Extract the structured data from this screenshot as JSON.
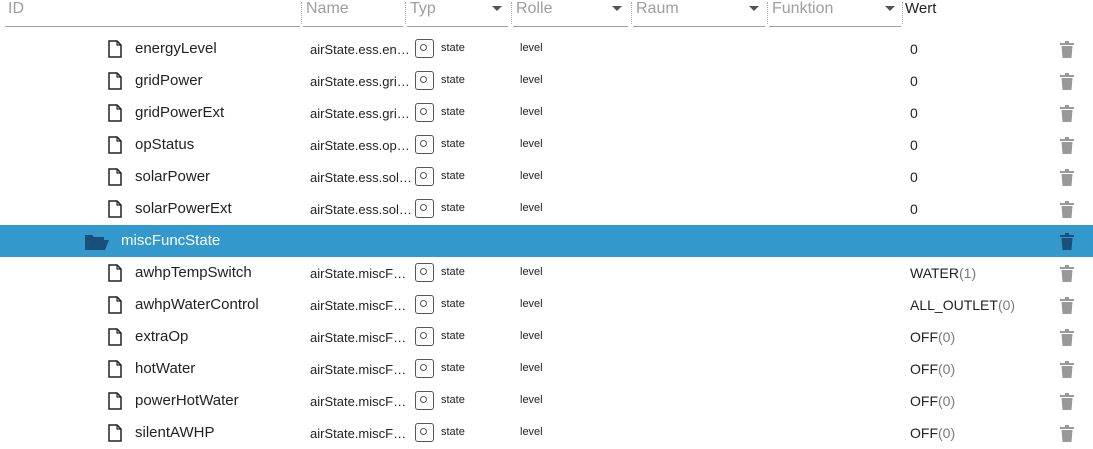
{
  "header": {
    "id_placeholder": "ID",
    "name_placeholder": "Name",
    "typ_label": "Typ",
    "rolle_label": "Rolle",
    "raum_label": "Raum",
    "funktion_label": "Funktion",
    "wert_label": "Wert"
  },
  "rows": [
    {
      "name": "energyLevel",
      "id": "airState.ess.energyLevel",
      "type": "state",
      "role": "level",
      "value": "0",
      "value_num": ""
    },
    {
      "name": "gridPower",
      "id": "airState.ess.gridPower",
      "type": "state",
      "role": "level",
      "value": "0",
      "value_num": ""
    },
    {
      "name": "gridPowerExt",
      "id": "airState.ess.gridPowerExt",
      "type": "state",
      "role": "level",
      "value": "0",
      "value_num": ""
    },
    {
      "name": "opStatus",
      "id": "airState.ess.opStatus",
      "type": "state",
      "role": "level",
      "value": "0",
      "value_num": ""
    },
    {
      "name": "solarPower",
      "id": "airState.ess.solarPower",
      "type": "state",
      "role": "level",
      "value": "0",
      "value_num": ""
    },
    {
      "name": "solarPowerExt",
      "id": "airState.ess.solarPowerExt",
      "type": "state",
      "role": "level",
      "value": "0",
      "value_num": ""
    }
  ],
  "folder": {
    "name": "miscFuncState"
  },
  "rows2": [
    {
      "name": "awhpTempSwitch",
      "id": "airState.miscFuncState.awhpTempSwitch",
      "type": "state",
      "role": "level",
      "value": "WATER",
      "value_num": "(1)"
    },
    {
      "name": "awhpWaterControl",
      "id": "airState.miscFuncState.awhpWaterControl",
      "type": "state",
      "role": "level",
      "value": "ALL_OUTLET",
      "value_num": "(0)"
    },
    {
      "name": "extraOp",
      "id": "airState.miscFuncState.extraOp",
      "type": "state",
      "role": "level",
      "value": "OFF",
      "value_num": "(0)"
    },
    {
      "name": "hotWater",
      "id": "airState.miscFuncState.hotWater",
      "type": "state",
      "role": "level",
      "value": "OFF",
      "value_num": "(0)"
    },
    {
      "name": "powerHotWater",
      "id": "airState.miscFuncState.powerHotWater",
      "type": "state",
      "role": "level",
      "value": "OFF",
      "value_num": "(0)"
    },
    {
      "name": "silentAWHP",
      "id": "airState.miscFuncState.silentAWHP",
      "type": "state",
      "role": "level",
      "value": "OFF",
      "value_num": "(0)"
    }
  ],
  "colors": {
    "selected_row": "#3399cc",
    "icon": "#999999"
  }
}
